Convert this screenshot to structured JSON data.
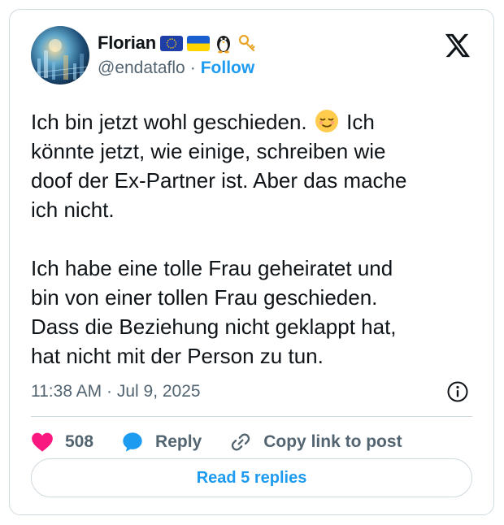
{
  "author": {
    "name": "Florian",
    "handle": "@endataflo",
    "separator": "·",
    "follow_label": "Follow",
    "badges": [
      "eu-flag-icon",
      "ukraine-flag-icon",
      "penguin-icon",
      "key-icon"
    ]
  },
  "tweet": {
    "text": "Ich bin jetzt wohl geschieden. [emoji] Ich könnte jetzt, wie einige, schreiben wie doof der Ex-Partner ist. Aber das mache ich nicht.\n\nIch habe eine tolle Frau geheiratet und bin von einer tollen Frau geschieden. Dass die Beziehung nicht geklappt hat, hat nicht mit der Person zu tun.",
    "text_part1": "Ich bin jetzt wohl geschieden.",
    "emoji": "relieved-face-icon",
    "text_part2": "Ich\nkönnte jetzt, wie einige, schreiben wie\ndoof der Ex-Partner ist. Aber das mache\nich nicht.\n\nIch habe eine tolle Frau geheiratet und\nbin von einer tollen Frau geschieden.\nDass die Beziehung nicht geklappt hat,\nhat nicht mit der Person zu tun.",
    "timestamp": "11:38 AM · Jul 9, 2025"
  },
  "actions": {
    "like_count": "508",
    "reply_label": "Reply",
    "copy_link_label": "Copy link to post"
  },
  "read_replies_label": "Read 5 replies",
  "colors": {
    "accent": "#1d9bf0",
    "like": "#f91880",
    "secondary_text": "#536471",
    "border": "#cfd9de"
  }
}
